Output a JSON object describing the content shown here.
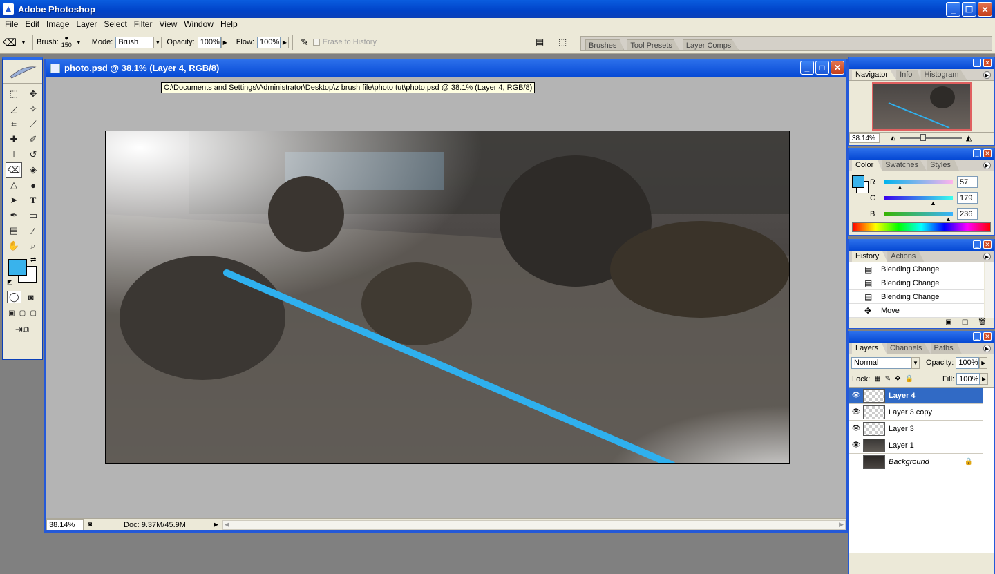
{
  "app": {
    "title": "Adobe Photoshop"
  },
  "menu": [
    "File",
    "Edit",
    "Image",
    "Layer",
    "Select",
    "Filter",
    "View",
    "Window",
    "Help"
  ],
  "options": {
    "brush_label": "Brush:",
    "brush_size": "150",
    "mode_label": "Mode:",
    "mode_value": "Brush",
    "opacity_label": "Opacity:",
    "opacity_value": "100%",
    "flow_label": "Flow:",
    "flow_value": "100%",
    "erase_history_label": "Erase to History"
  },
  "well_tabs": [
    "Brushes",
    "Tool Presets",
    "Layer Comps"
  ],
  "document": {
    "title": "photo.psd @ 38.1% (Layer 4, RGB/8)",
    "tooltip": "C:\\Documents and Settings\\Administrator\\Desktop\\z brush file\\photo tut\\photo.psd @ 38.1% (Layer 4, RGB/8)",
    "status_zoom": "38.14%",
    "doc_size": "Doc: 9.37M/45.9M"
  },
  "colors": {
    "foreground": "#39b3ec",
    "background": "#ffffff",
    "beam": "#2fb0ee"
  },
  "navigator": {
    "tabs": [
      "Navigator",
      "Info",
      "Histogram"
    ],
    "zoom": "38.14%"
  },
  "color_panel": {
    "tabs": [
      "Color",
      "Swatches",
      "Styles"
    ],
    "r_label": "R",
    "r_value": "57",
    "g_label": "G",
    "g_value": "179",
    "b_label": "B",
    "b_value": "236"
  },
  "history": {
    "tabs": [
      "History",
      "Actions"
    ],
    "items": [
      "Blending Change",
      "Blending Change",
      "Blending Change",
      "Move"
    ]
  },
  "layers": {
    "tabs": [
      "Layers",
      "Channels",
      "Paths"
    ],
    "blend_mode": "Normal",
    "opacity_label": "Opacity:",
    "opacity_value": "100%",
    "lock_label": "Lock:",
    "fill_label": "Fill:",
    "fill_value": "100%",
    "items": [
      "Layer 4",
      "Layer 3 copy",
      "Layer 3",
      "Layer 1",
      "Background"
    ]
  }
}
